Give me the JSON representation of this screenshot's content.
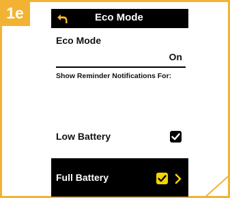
{
  "step": {
    "label": "1e"
  },
  "screen": {
    "title": "Eco Mode",
    "icons": {
      "back": "back-arrow-icon",
      "check": "checkmark-icon",
      "chevron": "chevron-right-icon"
    },
    "setting": {
      "name": "Eco Mode",
      "value": "On"
    },
    "reminder_label": "Show Reminder Notifications For:",
    "options": [
      {
        "label": "Low Battery",
        "checked": true,
        "selected": false
      },
      {
        "label": "Full Battery",
        "checked": true,
        "selected": true
      }
    ]
  },
  "colors": {
    "accent": "#f2b233",
    "highlight": "#f5d300",
    "bar": "#000000",
    "text": "#111111"
  }
}
